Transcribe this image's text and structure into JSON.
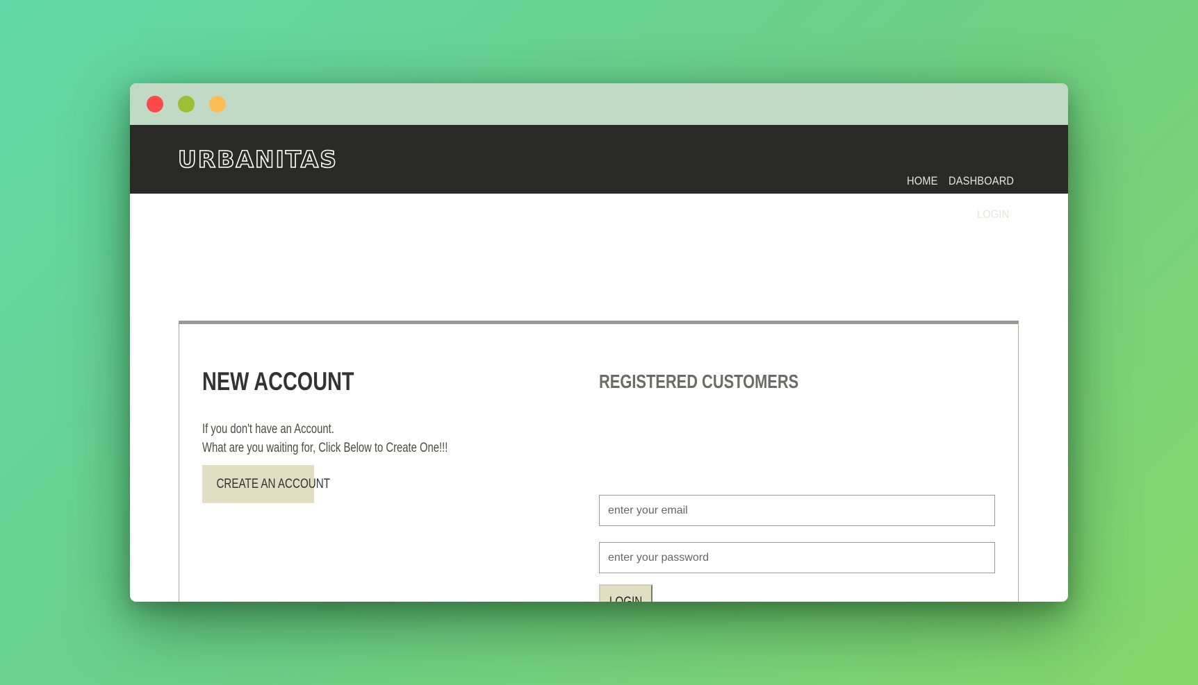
{
  "nav": {
    "logo": "URBANITAS",
    "links": [
      {
        "label": "HOME"
      },
      {
        "label": "DASHBOARD"
      },
      {
        "label": "LOGIN"
      }
    ]
  },
  "new_account": {
    "heading": "NEW ACCOUNT",
    "line1": "If you don't have an Account.",
    "line2": "What are you waiting for, Click Below to Create One!!!",
    "button_label": "CREATE AN ACCOUNT"
  },
  "registered": {
    "heading": "REGISTERED CUSTOMERS",
    "email_placeholder": "enter your email",
    "password_placeholder": "enter your password",
    "button_label": "LOGIN"
  },
  "colors": {
    "window_controls": [
      "#fa4a4a",
      "#9ebf33",
      "#ffbc54"
    ],
    "navbar": "#292925",
    "button": "#e2dec4"
  }
}
